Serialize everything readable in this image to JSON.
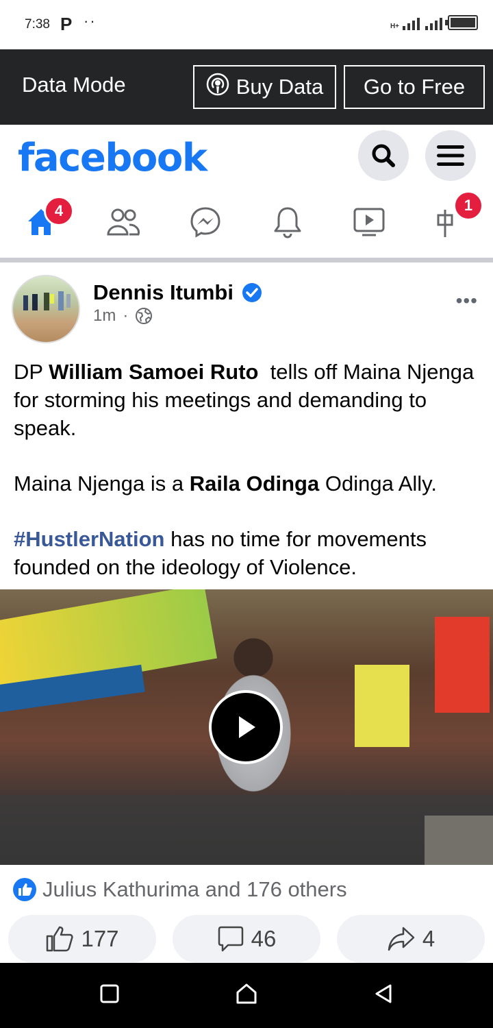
{
  "status_bar": {
    "time": "7:38",
    "p_icon": "P",
    "dots": "··",
    "network": "H+"
  },
  "data_mode": {
    "label": "Data Mode",
    "buy_label": "Buy Data",
    "free_label": "Go to Free"
  },
  "header": {
    "logo": "facebook",
    "nav": [
      {
        "icon": "home-icon",
        "badge": "4",
        "active": true
      },
      {
        "icon": "friends-icon"
      },
      {
        "icon": "messenger-icon"
      },
      {
        "icon": "bell-icon"
      },
      {
        "icon": "video-icon"
      },
      {
        "icon": "marketplace-icon",
        "badge": "1"
      }
    ]
  },
  "post": {
    "author": "Dennis Itumbi",
    "verified": true,
    "time": "1m",
    "separator": "·",
    "more": "•••",
    "body": {
      "p1_prefix": "DP ",
      "p1_bold": "William Samoei Ruto",
      "p1_rest": "  tells off Maina Njenga for storming his meetings and demanding to speak.",
      "p2_prefix": "Maina Njenga is a ",
      "p2_bold": "Raila Odinga",
      "p2_rest": " Odinga Ally.",
      "p3_hashtag": "#HustlerNation",
      "p3_rest": " has no time for movements founded on the ideology of Violence."
    },
    "reactions_text": "Julius Kathurima and 176 others",
    "like_count": "177",
    "comment_count": "46",
    "share_count": "4"
  },
  "colors": {
    "brand": "#1877f2",
    "badge": "#e41e3f",
    "data_bar": "#242526",
    "hashtag": "#385898"
  }
}
